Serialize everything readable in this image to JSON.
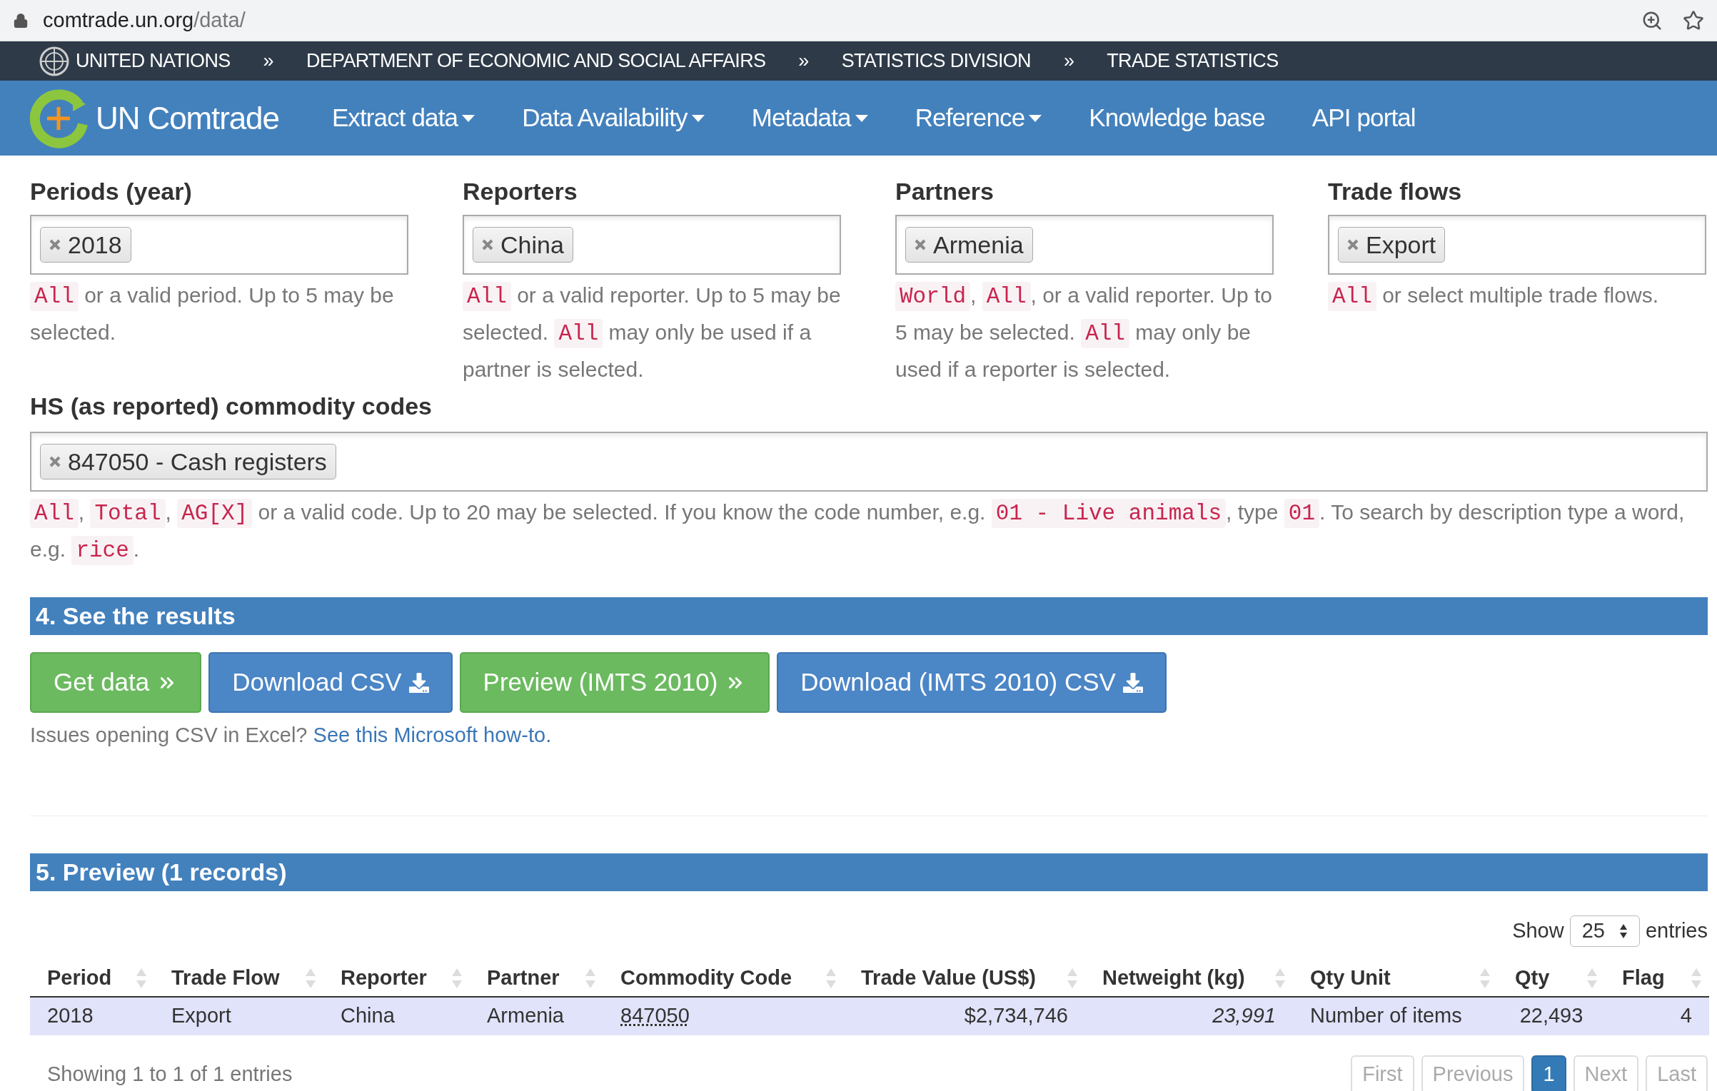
{
  "browser": {
    "url_host": "comtrade.un.org",
    "url_path": "/data/"
  },
  "breadcrumb": [
    {
      "kind": "link",
      "text": "UNITED NATIONS"
    },
    {
      "kind": "separator",
      "text": "»"
    },
    {
      "kind": "link",
      "text": "DEPARTMENT OF ECONOMIC AND SOCIAL AFFAIRS"
    },
    {
      "kind": "separator",
      "text": "»"
    },
    {
      "kind": "link",
      "text": "STATISTICS DIVISION"
    },
    {
      "kind": "separator",
      "text": "»"
    },
    {
      "kind": "link",
      "text": "TRADE STATISTICS"
    }
  ],
  "nav": {
    "brand": "UN Comtrade",
    "items": [
      {
        "label": "Extract data",
        "dropdown": true
      },
      {
        "label": "Data Availability",
        "dropdown": true
      },
      {
        "label": "Metadata",
        "dropdown": true
      },
      {
        "label": "Reference",
        "dropdown": true
      },
      {
        "label": "Knowledge base",
        "dropdown": false
      },
      {
        "label": "API portal",
        "dropdown": false
      }
    ]
  },
  "filters": [
    {
      "label": "Periods (year)",
      "tags": [
        "2018"
      ],
      "help": [
        {
          "kind": "code",
          "text": "All"
        },
        {
          "kind": "text",
          "text": " or a valid period. Up to 5 may be selected."
        }
      ]
    },
    {
      "label": "Reporters",
      "tags": [
        "China"
      ],
      "help": [
        {
          "kind": "code",
          "text": "All"
        },
        {
          "kind": "text",
          "text": " or a valid reporter. Up to 5 may be selected. "
        },
        {
          "kind": "code",
          "text": "All"
        },
        {
          "kind": "text",
          "text": " may only be used if a partner is selected."
        }
      ]
    },
    {
      "label": "Partners",
      "tags": [
        "Armenia"
      ],
      "help": [
        {
          "kind": "code",
          "text": "World"
        },
        {
          "kind": "text",
          "text": ", "
        },
        {
          "kind": "code",
          "text": "All"
        },
        {
          "kind": "text",
          "text": ", or a valid reporter. Up to 5 may be selected. "
        },
        {
          "kind": "code",
          "text": "All"
        },
        {
          "kind": "text",
          "text": " may only be used if a reporter is selected."
        }
      ]
    },
    {
      "label": "Trade flows",
      "tags": [
        "Export"
      ],
      "help": [
        {
          "kind": "code",
          "text": "All"
        },
        {
          "kind": "text",
          "text": " or select multiple trade flows."
        }
      ]
    }
  ],
  "commodity": {
    "label": "HS (as reported) commodity codes",
    "tags": [
      "847050 - Cash registers"
    ],
    "help": [
      {
        "kind": "code",
        "text": "All"
      },
      {
        "kind": "text",
        "text": ", "
      },
      {
        "kind": "code",
        "text": "Total"
      },
      {
        "kind": "text",
        "text": ", "
      },
      {
        "kind": "code",
        "text": "AG[X]"
      },
      {
        "kind": "text",
        "text": " or a valid code. Up to 20 may be selected. If you know the code number, e.g. "
      },
      {
        "kind": "code",
        "text": "01 - Live animals"
      },
      {
        "kind": "text",
        "text": ", type "
      },
      {
        "kind": "code",
        "text": "01"
      },
      {
        "kind": "text",
        "text": ". To search by description type a word, e.g. "
      },
      {
        "kind": "code",
        "text": "rice"
      },
      {
        "kind": "text",
        "text": "."
      }
    ]
  },
  "results": {
    "title": "4. See the results",
    "buttons": [
      {
        "label": "Get data",
        "kind": "success"
      },
      {
        "label": "Download CSV",
        "kind": "primary"
      },
      {
        "label": "Preview (IMTS 2010)",
        "kind": "success"
      },
      {
        "label": "Download (IMTS 2010) CSV",
        "kind": "primary"
      }
    ],
    "note": "Issues opening CSV in Excel?",
    "note_link": "See this Microsoft how-to."
  },
  "preview": {
    "title": "5. Preview (1 records)",
    "show_label": "Show",
    "page_size": "25",
    "entries_label": "entries",
    "columns": [
      {
        "label": "Period"
      },
      {
        "label": "Trade Flow"
      },
      {
        "label": "Reporter"
      },
      {
        "label": "Partner"
      },
      {
        "label": "Commodity Code"
      },
      {
        "label": "Trade Value (US$)"
      },
      {
        "label": "Netweight (kg)"
      },
      {
        "label": "Qty Unit"
      },
      {
        "label": "Qty"
      },
      {
        "label": "Flag"
      }
    ],
    "rows": [
      [
        {
          "text": "2018",
          "kind": "text"
        },
        {
          "text": "Export",
          "kind": "text"
        },
        {
          "text": "China",
          "kind": "text"
        },
        {
          "text": "Armenia",
          "kind": "text"
        },
        {
          "text": "847050",
          "kind": "abbr"
        },
        {
          "text": "$2,734,746",
          "kind": "number"
        },
        {
          "text": "23,991",
          "kind": "estimate"
        },
        {
          "text": "Number of items",
          "kind": "text"
        },
        {
          "text": "22,493",
          "kind": "center"
        },
        {
          "text": "4",
          "kind": "number"
        }
      ]
    ],
    "info": "Showing 1 to 1 of 1 entries",
    "pages": [
      {
        "label": "First",
        "selected": false,
        "disabled": true
      },
      {
        "label": "Previous",
        "selected": false,
        "disabled": true
      },
      {
        "label": "1",
        "selected": true,
        "disabled": false
      },
      {
        "label": "Next",
        "selected": false,
        "disabled": true
      },
      {
        "label": "Last",
        "selected": false,
        "disabled": true
      }
    ]
  }
}
